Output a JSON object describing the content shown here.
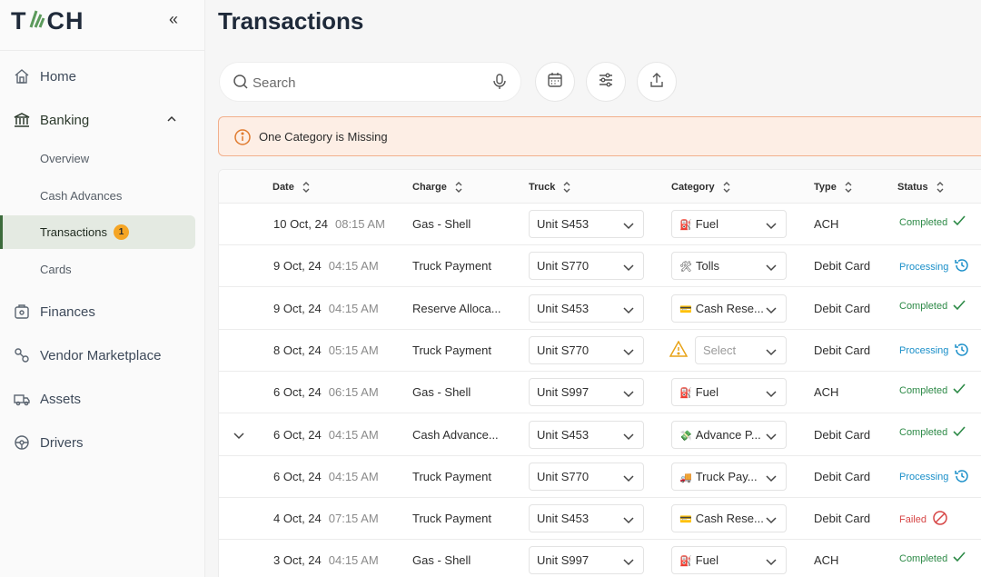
{
  "brand": {
    "letters_left": "T",
    "letters_right": "CH"
  },
  "sidebar": {
    "items": [
      {
        "label": "Home",
        "icon": "home-icon"
      },
      {
        "label": "Banking",
        "icon": "bank-icon"
      },
      {
        "label": "Finances",
        "icon": "wallet-icon"
      },
      {
        "label": "Vendor Marketplace",
        "icon": "marketplace-icon"
      },
      {
        "label": "Assets",
        "icon": "truck-icon"
      },
      {
        "label": "Drivers",
        "icon": "steering-wheel-icon"
      }
    ],
    "banking_sub": [
      "Overview",
      "Cash Advances",
      "Transactions",
      "Cards"
    ],
    "transactions_badge": "1"
  },
  "page": {
    "title": "Transactions",
    "search_placeholder": "Search",
    "alert": "One Category is Missing"
  },
  "table": {
    "headers": [
      "Date",
      "Charge",
      "Truck",
      "Category",
      "Type",
      "Status"
    ],
    "rows": [
      {
        "date": "10 Oct, 24",
        "time": "08:15 AM",
        "charge": "Gas - Shell",
        "truck": "Unit S453",
        "category": "Fuel",
        "cat_icon": "⛽",
        "type": "ACH",
        "status": "Completed"
      },
      {
        "date": "9 Oct, 24",
        "time": "04:15 AM",
        "charge": "Truck Payment",
        "truck": "Unit S770",
        "category": "Tolls",
        "cat_icon": "🛠",
        "type": "Debit Card",
        "status": "Processing"
      },
      {
        "date": "9 Oct, 24",
        "time": "04:15 AM",
        "charge": "Reserve Alloca...",
        "truck": "Unit S453",
        "category": "Cash Rese...",
        "cat_icon": "💳",
        "type": "Debit Card",
        "status": "Completed"
      },
      {
        "date": "8 Oct, 24",
        "time": "05:15 AM",
        "charge": "Truck Payment",
        "truck": "Unit S770",
        "category": "Select",
        "cat_icon": "",
        "type": "Debit Card",
        "status": "Processing"
      },
      {
        "date": "6 Oct, 24",
        "time": "06:15 AM",
        "charge": "Gas - Shell",
        "truck": "Unit S997",
        "category": "Fuel",
        "cat_icon": "⛽",
        "type": "ACH",
        "status": "Completed"
      },
      {
        "date": "6 Oct, 24",
        "time": "04:15 AM",
        "charge": "Cash Advance...",
        "truck": "Unit S453",
        "category": "Advance P...",
        "cat_icon": "💸",
        "type": "Debit Card",
        "status": "Completed"
      },
      {
        "date": "6 Oct, 24",
        "time": "04:15 AM",
        "charge": "Truck Payment",
        "truck": "Unit S770",
        "category": "Truck Pay...",
        "cat_icon": "🚚",
        "type": "Debit Card",
        "status": "Processing"
      },
      {
        "date": "4 Oct, 24",
        "time": "07:15 AM",
        "charge": "Truck Payment",
        "truck": "Unit S453",
        "category": "Cash Rese...",
        "cat_icon": "💳",
        "type": "Debit Card",
        "status": "Failed"
      },
      {
        "date": "3 Oct, 24",
        "time": "04:15 AM",
        "charge": "Gas - Shell",
        "truck": "Unit S997",
        "category": "Fuel",
        "cat_icon": "⛽",
        "type": "ACH",
        "status": "Completed"
      }
    ]
  }
}
